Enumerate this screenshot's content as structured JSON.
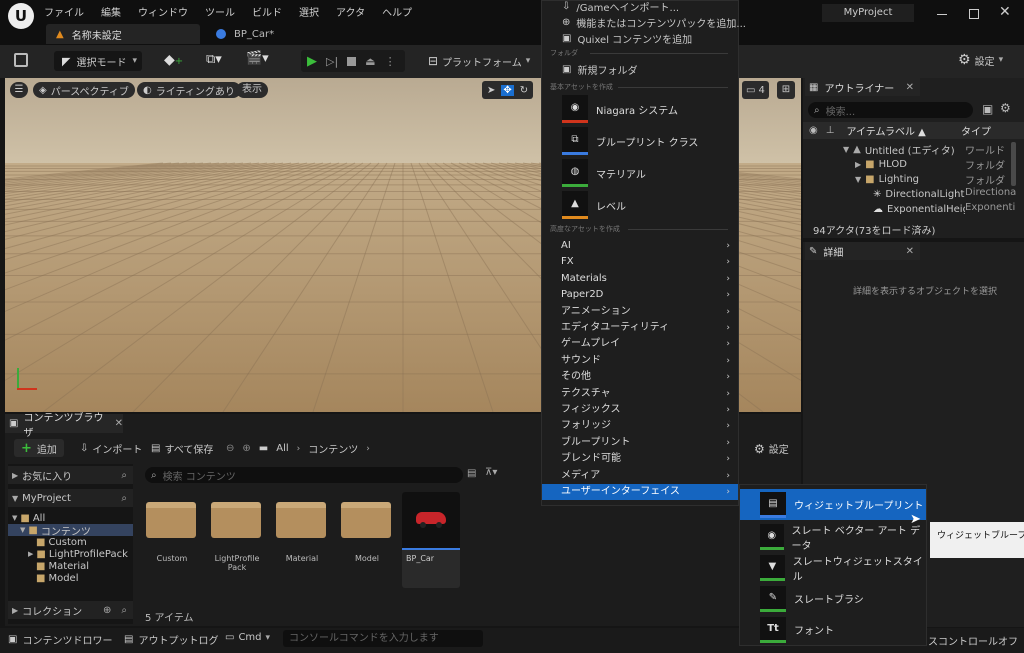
{
  "menubar": {
    "items": [
      "ファイル",
      "編集",
      "ウィンドウ",
      "ツール",
      "ビルド",
      "選択",
      "アクタ",
      "ヘルプ"
    ],
    "project": "MyProject"
  },
  "tabs": [
    {
      "label": "名称未設定"
    },
    {
      "label": "BP_Car*"
    }
  ],
  "toolbar": {
    "select_mode": "選択モード",
    "platform": "プラットフォーム",
    "settings": "設定"
  },
  "viewport": {
    "perspective": "パースペクティブ",
    "lighting": "ライティングあり",
    "show": "表示",
    "camera_speed": "4"
  },
  "outliner": {
    "title": "アウトライナー",
    "search_placeholder": "検索...",
    "col_label": "アイテムラベル ▲",
    "col_type": "タイプ",
    "rows": [
      {
        "label": "Untitled (エディタ)",
        "type": "ワールド"
      },
      {
        "label": "HLOD",
        "type": "フォルダ"
      },
      {
        "label": "Lighting",
        "type": "フォルダ"
      },
      {
        "label": "DirectionalLight",
        "type": "Directiona"
      },
      {
        "label": "ExponentialHeig",
        "type": "Exponenti"
      }
    ],
    "status": "94アクタ(73をロード済み)"
  },
  "details": {
    "title": "詳細",
    "empty": "詳細を表示するオブジェクトを選択"
  },
  "content_browser": {
    "tab": "コンテンツブラウザ",
    "add": "追加",
    "import": "インポート",
    "save_all": "すべて保存",
    "path_all": "All",
    "path_content": "コンテンツ",
    "settings": "設定",
    "favorites": "お気に入り",
    "project": "MyProject",
    "tree": [
      "All",
      "コンテンツ",
      "Custom",
      "LightProfilePack",
      "Material",
      "Model"
    ],
    "collections": "コレクション",
    "search_placeholder": "検索 コンテンツ",
    "assets": [
      {
        "name": "Custom"
      },
      {
        "name": "LightProfile\nPack"
      },
      {
        "name": "Material"
      },
      {
        "name": "Model"
      },
      {
        "name": "BP_Car"
      }
    ],
    "item_count": "5 アイテム"
  },
  "bottom_bar": {
    "drawer": "コンテンツドロワー",
    "output_log": "アウトプットログ",
    "cmd": "Cmd",
    "console_placeholder": "コンソールコマンドを入力します",
    "source_control": "スコントロールオフ"
  },
  "context_menu": {
    "top_items": [
      "/Gameへインポート...",
      "機能またはコンテンツパックを追加...",
      "Quixel コンテンツを追加"
    ],
    "folder_header": "フォルダ",
    "new_folder": "新規フォルダ",
    "basic_header": "基本アセットを作成",
    "basic_items": [
      {
        "label": "Niagara システム",
        "accent": "#d0341c"
      },
      {
        "label": "ブループリント クラス",
        "accent": "#3a7be0"
      },
      {
        "label": "マテリアル",
        "accent": "#3bab3b"
      },
      {
        "label": "レベル",
        "accent": "#e08a1e"
      }
    ],
    "advanced_header": "高度なアセットを作成",
    "advanced_items": [
      "AI",
      "FX",
      "Materials",
      "Paper2D",
      "アニメーション",
      "エディタユーティリティ",
      "ゲームプレイ",
      "サウンド",
      "その他",
      "テクスチャ",
      "フィジックス",
      "フォリッジ",
      "ブループリント",
      "ブレンド可能",
      "メディア",
      "ユーザーインターフェイス"
    ]
  },
  "submenu": {
    "items": [
      {
        "label": "ウィジェットブループリント"
      },
      {
        "label": "スレート ベクター アート データ"
      },
      {
        "label": "スレートウィジェットスタイル"
      },
      {
        "label": "スレートブラシ"
      },
      {
        "label": "フォント"
      }
    ],
    "tooltip": "ウィジェットブループリ"
  }
}
